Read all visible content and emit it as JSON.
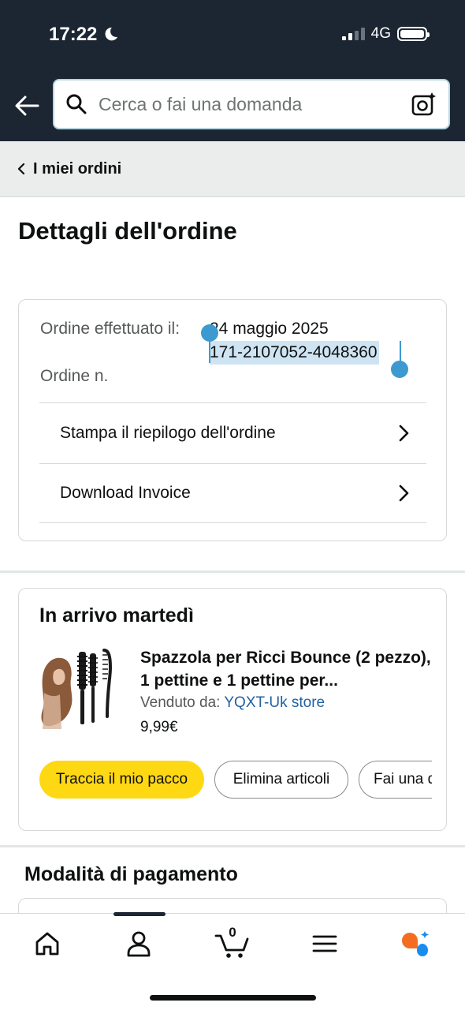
{
  "status_bar": {
    "time": "17:22",
    "network": "4G"
  },
  "search": {
    "placeholder": "Cerca o fai una domanda"
  },
  "breadcrumb": {
    "label": "I miei ordini"
  },
  "page": {
    "title": "Dettagli dell'ordine"
  },
  "order": {
    "placed_label": "Ordine effettuato il:",
    "number_label": "Ordine n.",
    "placed_date": "24 maggio 2025",
    "number": "171-2107052-4048360"
  },
  "actions": {
    "print_summary": "Stampa il riepilogo dell'ordine",
    "download_invoice": "Download Invoice"
  },
  "shipment": {
    "heading": "In arrivo martedì",
    "product_title": "Spazzola per Ricci Bounce (2 pezzo), 1 pettine e 1 pettine per...",
    "sold_by_label": "Venduto da:",
    "seller": "YQXT-Uk store",
    "price": "9,99€",
    "buttons": {
      "track": "Traccia il mio pacco",
      "delete": "Elimina articoli",
      "ask": "Fai una d"
    }
  },
  "payment": {
    "heading": "Modalità di pagamento"
  },
  "bottom_nav": {
    "cart_count": "0"
  },
  "colors": {
    "header_bg": "#1c2633",
    "primary_button": "#ffd814",
    "link": "#2162a1",
    "selection": "#cfe4f3",
    "selection_handle": "#3d9ad0",
    "assistant_orange": "#f36c21",
    "assistant_blue": "#1a8cf0"
  }
}
